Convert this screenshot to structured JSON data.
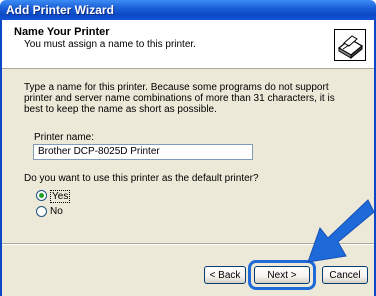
{
  "window": {
    "title": "Add Printer Wizard"
  },
  "header": {
    "title": "Name Your Printer",
    "subtitle": "You must assign a name to this printer.",
    "icon": "printer-wizard-icon"
  },
  "description": "Type a name for this printer. Because some programs do not support printer and server name combinations of more than 31 characters, it is best to keep the name as short as possible.",
  "printer_name": {
    "label_prefix": "Printer name:",
    "value": "Brother DCP-8025D Printer"
  },
  "default_printer": {
    "question": "Do you want to use this printer as the default printer?",
    "options": [
      {
        "label": "Yes",
        "checked": true
      },
      {
        "label": "No",
        "checked": false
      }
    ]
  },
  "buttons": {
    "back": "< Back",
    "next": "Next >",
    "cancel": "Cancel"
  },
  "colors": {
    "titlebar": "#0b49c6",
    "highlight": "#1e6ad8",
    "window_bg": "#ece9d8"
  }
}
